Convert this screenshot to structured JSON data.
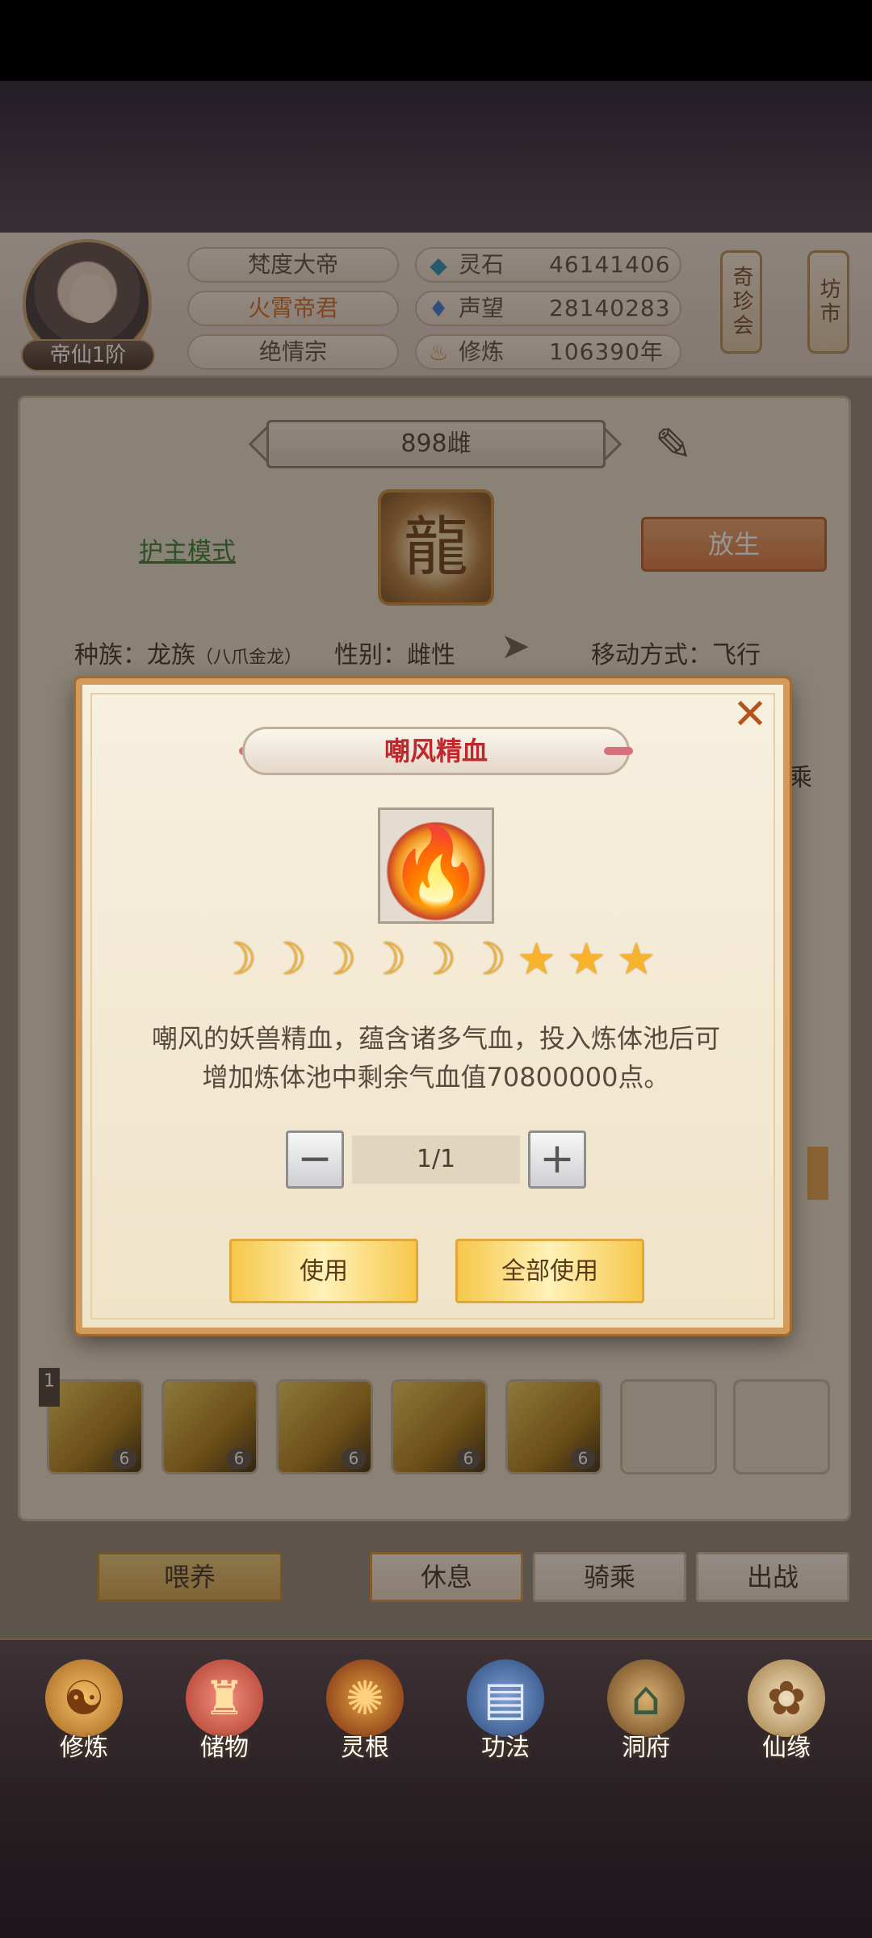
{
  "header": {
    "rank_badge": "帝仙1阶",
    "names": [
      "梵度大帝",
      "火霄帝君",
      "绝情宗"
    ],
    "stats": [
      {
        "icon": "spirit-stone-icon",
        "label": "灵石",
        "value": "46141406"
      },
      {
        "icon": "prestige-icon",
        "label": "声望",
        "value": "28140283"
      },
      {
        "icon": "cultivation-icon",
        "label": "修炼",
        "value": "106390年"
      }
    ],
    "treasure_button": "奇珍会",
    "market_button": "坊市"
  },
  "pet": {
    "name": "898雌",
    "guard_mode": "护主模式",
    "release_button": "放生",
    "race_label": "种族：龙族",
    "race_sub": "（八爪金龙）",
    "gender": "性别：雌性",
    "move": "移动方式：飞行",
    "side_text": "乘"
  },
  "slots": {
    "counts": [
      "6",
      "6",
      "6",
      "6",
      "6"
    ],
    "first_badge": "1"
  },
  "actions": {
    "feed": "喂养",
    "rest": "休息",
    "ride": "骑乘",
    "battle": "出战"
  },
  "nav": [
    {
      "icon": "cultivate-icon",
      "label": "修炼"
    },
    {
      "icon": "storage-icon",
      "label": "储物"
    },
    {
      "icon": "spirit-root-icon",
      "label": "灵根"
    },
    {
      "icon": "skill-icon",
      "label": "功法"
    },
    {
      "icon": "cave-icon",
      "label": "洞府"
    },
    {
      "icon": "fate-icon",
      "label": "仙缘"
    }
  ],
  "dialog": {
    "title": "嘲风精血",
    "rating": {
      "moons": 6,
      "stars": 3
    },
    "description_line1": "嘲风的妖兽精血，蕴含诸多气血，投入炼体池后可",
    "description_line2": "增加炼体池中剩余气血值70800000点。",
    "quantity": "1/1",
    "use_button": "使用",
    "use_all_button": "全部使用"
  },
  "colors": {
    "accent_orange": "#d9773f",
    "title_red": "#c0272d",
    "gold": "#f6c74a"
  }
}
